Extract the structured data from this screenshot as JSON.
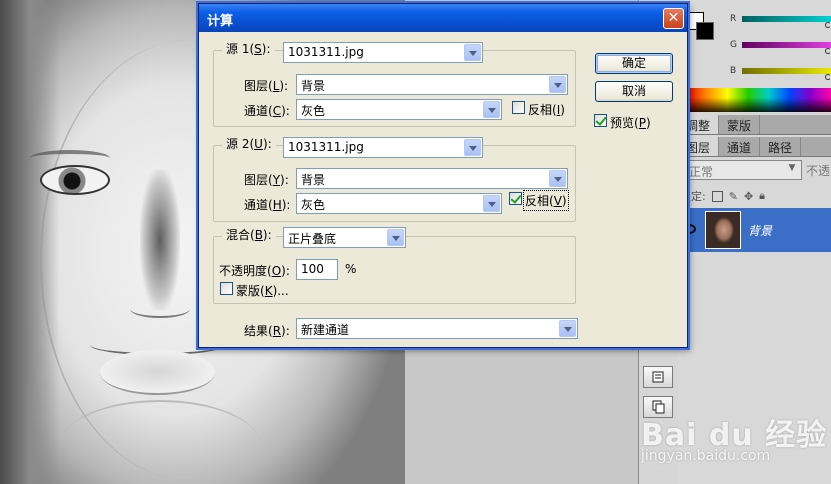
{
  "dialog": {
    "title": "计算",
    "close_glyph": "✕",
    "source1": {
      "legend_prefix": "源 1(",
      "legend_key": "S",
      "legend_suffix": "):",
      "file": "1031311.jpg",
      "layer_label_prefix": "图层(",
      "layer_label_key": "L",
      "layer_label_suffix": "):",
      "layer_value": "背景",
      "channel_label_prefix": "通道(",
      "channel_label_key": "C",
      "channel_label_suffix": "):",
      "channel_value": "灰色",
      "invert_prefix": "反相(",
      "invert_key": "I",
      "invert_suffix": ")",
      "invert_checked": false
    },
    "source2": {
      "legend_prefix": "源 2(",
      "legend_key": "U",
      "legend_suffix": "):",
      "file": "1031311.jpg",
      "layer_label_prefix": "图层(",
      "layer_label_key": "Y",
      "layer_label_suffix": "):",
      "layer_value": "背景",
      "channel_label_prefix": "通道(",
      "channel_label_key": "H",
      "channel_label_suffix": "):",
      "channel_value": "灰色",
      "invert_prefix": "反相(",
      "invert_key": "V",
      "invert_suffix": ")",
      "invert_checked": true
    },
    "blend": {
      "label_prefix": "混合(",
      "label_key": "B",
      "label_suffix": "):",
      "value": "正片叠底",
      "opacity_label_prefix": "不透明度(",
      "opacity_label_key": "O",
      "opacity_label_suffix": "):",
      "opacity_value": "100",
      "opacity_unit": "%",
      "mask_prefix": "蒙版(",
      "mask_key": "K",
      "mask_suffix": ")...",
      "mask_checked": false
    },
    "result": {
      "label_prefix": "结果(",
      "label_key": "R",
      "label_suffix": "):",
      "value": "新建通道"
    },
    "ok_label": "确定",
    "cancel_label": "取消",
    "preview_prefix": "预览(",
    "preview_key": "P",
    "preview_suffix": ")",
    "preview_checked": true
  },
  "panels": {
    "color_sliders": [
      {
        "label": "R",
        "color": "#00d0d0"
      },
      {
        "label": "G",
        "color": "#e040e0"
      },
      {
        "label": "B",
        "color": "#e8e800"
      }
    ],
    "adjust_tabs": [
      "调整",
      "蒙版"
    ],
    "layer_tabs": [
      "图层",
      "通道",
      "路径"
    ],
    "blend_mode": "正常",
    "opacity_label": "不透",
    "lock_label": "锁定:",
    "layer_name": "背景"
  },
  "watermark": {
    "brand": "Bai du 经验",
    "url": "jingyan.baidu.com"
  },
  "colors": {
    "title_blue": "#0a5fe6",
    "selected_layer": "#3a6ec7",
    "dialog_bg": "#ece9d8"
  }
}
